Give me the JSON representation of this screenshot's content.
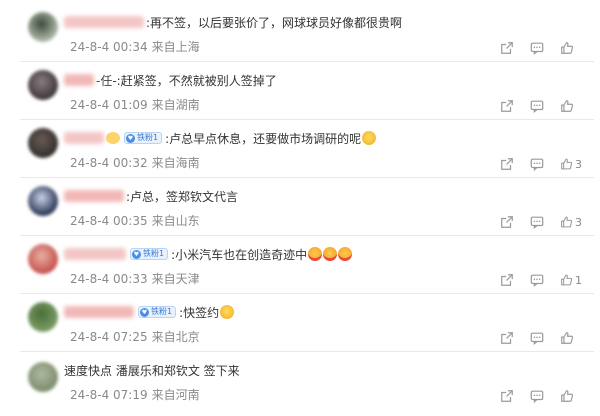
{
  "comments": [
    {
      "name_fragment": "",
      "text": ":再不签，以后要张价了，网球球员好像都很贵啊",
      "date": "24-8-4 00:34",
      "location": "来自上海",
      "likes": "",
      "badge": "",
      "emojis": [],
      "avatar_colors": [
        "#b8c2b0",
        "#3d4a3c"
      ]
    },
    {
      "name_fragment": "-任-",
      "text": ":赶紧签，不然就被别人签掉了",
      "date": "24-8-4 01:09",
      "location": "来自湖南",
      "likes": "",
      "badge": "",
      "emojis": [],
      "avatar_colors": [
        "#3a3236",
        "#8a7c80"
      ]
    },
    {
      "name_fragment": "",
      "text": ":卢总早点休息，还要做市场调研的呢",
      "date": "24-8-4 00:32",
      "location": "来自海南",
      "likes": "3",
      "badge": "铁粉1",
      "emojis": [
        "smile"
      ],
      "avatar_colors": [
        "#2d2d2d",
        "#6a5a50"
      ]
    },
    {
      "name_fragment": "",
      "text": ":卢总，签郑钦文代言",
      "date": "24-8-4 00:35",
      "location": "来自山东",
      "likes": "3",
      "badge": "",
      "emojis": [],
      "avatar_colors": [
        "#1e2a4a",
        "#c8d4e8"
      ]
    },
    {
      "name_fragment": "",
      "text": ":小米汽车也在创造奇迹中",
      "date": "24-8-4 00:33",
      "location": "来自天津",
      "likes": "1",
      "badge": "铁粉1",
      "emojis": [
        "love",
        "love",
        "love"
      ],
      "avatar_colors": [
        "#c24a4a",
        "#e8b0a0"
      ]
    },
    {
      "name_fragment": "",
      "text": ":快签约",
      "date": "24-8-4 07:25",
      "location": "来自北京",
      "likes": "",
      "badge": "铁粉1",
      "emojis": [
        "smile"
      ],
      "avatar_colors": [
        "#7da06a",
        "#4b6e3a"
      ]
    },
    {
      "name_fragment": "",
      "text": "速度快点 潘展乐和郑钦文 签下来",
      "date": "24-8-4 07:19",
      "location": "来自河南",
      "likes": "",
      "badge": "",
      "emojis": [],
      "avatar_colors": [
        "#7a8a6a",
        "#b0b8a0"
      ]
    }
  ],
  "icons": {
    "share": "share-icon",
    "comment": "comment-icon",
    "like": "thumbs-up-icon"
  }
}
